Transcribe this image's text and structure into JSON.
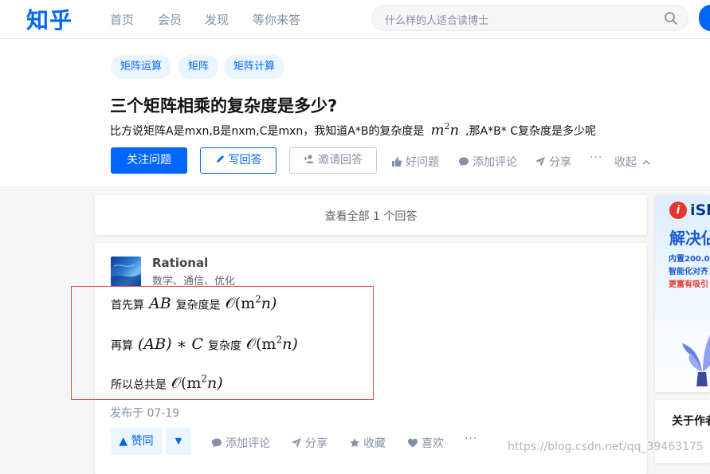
{
  "brand": {
    "logo": "知乎"
  },
  "nav": [
    "首页",
    "会员",
    "发现",
    "等你来答"
  ],
  "search": {
    "placeholder": "什么样的人适合读博士"
  },
  "question": {
    "tags": [
      "矩阵运算",
      "矩阵",
      "矩阵计算"
    ],
    "title": "三个矩阵相乘的复杂度是多少?",
    "desc_prefix": "比方说矩阵A是mxn,B是nxm,C是mxn，我知道A*B的复杂度是",
    "desc_math_base": "m",
    "desc_math_exp": "2",
    "desc_math_tail": "n",
    "desc_suffix": ",那A*B* C复杂度是多少呢",
    "buttons": {
      "follow": "关注问题",
      "write": "写回答",
      "invite": "邀请回答",
      "good": "好问题",
      "comment": "添加评论",
      "share": "分享",
      "more": "···",
      "collapse": "收起"
    }
  },
  "view_all": "查看全部 1 个回答",
  "answer": {
    "author": "Rational",
    "bio": "数学、通信、优化",
    "lines": [
      {
        "text1": "首先算",
        "math1": "AB",
        "text2": "复杂度是",
        "math2_pre": "𝒪(m",
        "math2_exp": "2",
        "math2_post": "n)"
      },
      {
        "text1": "再算",
        "math1": "(AB) ∗ C",
        "text2": "复杂度",
        "math2_pre": "𝒪(m",
        "math2_exp": "2",
        "math2_post": "n)"
      },
      {
        "text1": "所以总共是",
        "math2_pre": "𝒪(m",
        "math2_exp": "2",
        "math2_post": "n)"
      }
    ],
    "date": "发布于 07-19",
    "vote_up": "▲ 赞同",
    "vote_down": "▼",
    "actions": {
      "comment": "添加评论",
      "share": "分享",
      "collect": "收藏",
      "like": "喜欢",
      "more": "···"
    }
  },
  "sidebar": {
    "ad": {
      "logo_letter": "i",
      "brand": "iSl",
      "title": "解决佔",
      "lines": [
        "内置200.0",
        "智能化对齐",
        "更富有吸引"
      ]
    },
    "about_title": "关于作者"
  },
  "watermark": "https://blog.csdn.net/qq_39463175"
}
